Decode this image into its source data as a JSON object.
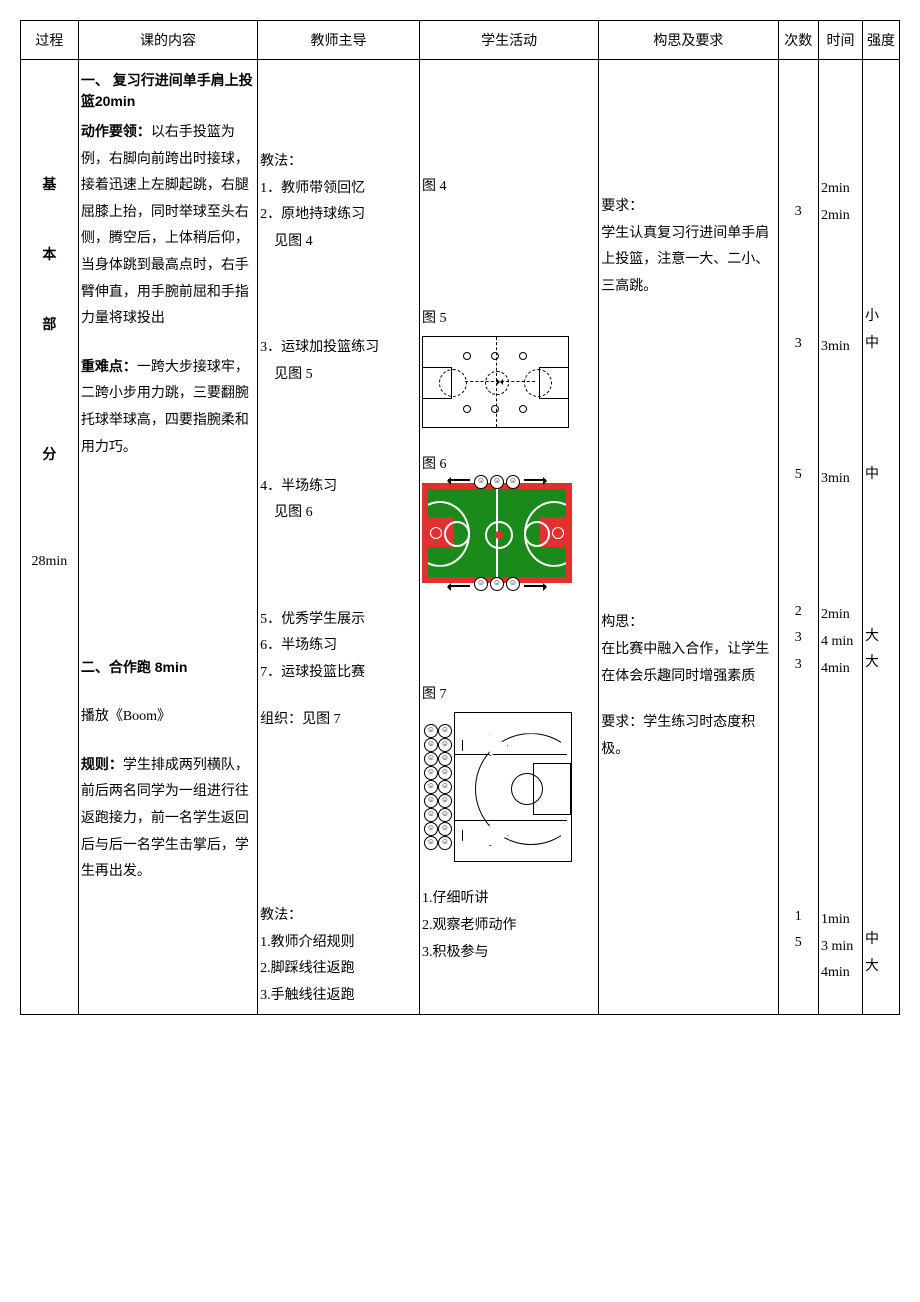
{
  "headers": {
    "process": "过程",
    "content": "课的内容",
    "teacher": "教师主导",
    "student": "学生活动",
    "idea": "构思及要求",
    "count": "次数",
    "time": "时间",
    "intensity": "强度"
  },
  "process": {
    "c1": "基",
    "c2": "本",
    "c3": "部",
    "c4": "分",
    "duration": "28min"
  },
  "content": {
    "sec1_title": "一、 复习行进间单手肩上投篮20min",
    "sec1_action_label": "动作要领：",
    "sec1_action_text": "以右手投篮为例，右脚向前跨出时接球，接着迅速上左脚起跳，右腿屈膝上抬，同时举球至头右侧，腾空后，上体稍后仰，当身体跳到最高点时，右手臂伸直，用手腕前屈和手指力量将球投出",
    "sec1_diff_label": "重难点：",
    "sec1_diff_text": "一跨大步接球牢，二跨小步用力跳，三要翻腕托球举球高，四要指腕柔和用力巧。",
    "sec2_title": "二、合作跑 8min",
    "sec2_music": "播放《Boom》",
    "sec2_rule_label": "规则：",
    "sec2_rule_text": "学生排成两列横队，前后两名同学为一组进行往返跑接力，前一名学生返回后与后一名学生击掌后，学生再出发。"
  },
  "teacher": {
    "method_label": "教法：",
    "m1": "1．教师带领回忆",
    "m2": "2．原地持球练习",
    "m2b": "见图 4",
    "m3": "3．运球加投篮练习",
    "m3b": "见图 5",
    "m4": "4．半场练习",
    "m4b": "见图 6",
    "m5": "5．优秀学生展示",
    "m6": "6．半场练习",
    "m7": "7．运球投篮比赛",
    "org": "组织：见图 7",
    "method2_label": "教法：",
    "t1": "1.教师介绍规则",
    "t2": "2.脚踩线往返跑",
    "t3": "3.手触线往返跑"
  },
  "student": {
    "f4": "图 4",
    "f5": "图 5",
    "f6": "图 6",
    "f7": "图 7",
    "s1": "1.仔细听讲",
    "s2": "2.观察老师动作",
    "s3": "3.积极参与"
  },
  "idea": {
    "req_label": "要求：",
    "req_text": "学生认真复习行进间单手肩上投篮，注意一大、二小、三高跳。",
    "think_label": "构思：",
    "think_text": "在比赛中融入合作，让学生在体会乐趣同时增强素质",
    "req2_label": "要求：",
    "req2_text": "学生练习时态度积极。"
  },
  "metrics": {
    "r1": {
      "count": "3",
      "time1": "2min",
      "time2": "2min",
      "intensity": ""
    },
    "r2": {
      "count": "3",
      "time": "3min",
      "intensity": "小\n中"
    },
    "r3": {
      "count": "5",
      "time": "3min",
      "intensity": "中"
    },
    "r4": {
      "count": "2",
      "time": "2min",
      "intensity": ""
    },
    "r5": {
      "count": "3",
      "time": "4 min",
      "intensity": "大"
    },
    "r6": {
      "count": "3",
      "time": "4min",
      "intensity": "大"
    },
    "r7": {
      "count": "1",
      "time": "1min",
      "intensity": ""
    },
    "r8": {
      "count": "5",
      "time": "3 min",
      "intensity": "中"
    },
    "r9": {
      "count": "",
      "time": "4min",
      "intensity": "大"
    }
  }
}
